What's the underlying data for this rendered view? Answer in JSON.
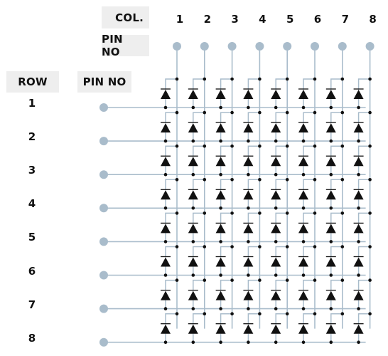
{
  "header": {
    "col_label": "COL.",
    "col_pin_label": "PIN NO",
    "row_label": "ROW",
    "row_pin_label": "PIN NO"
  },
  "columns": [
    "1",
    "2",
    "3",
    "4",
    "5",
    "6",
    "7",
    "8"
  ],
  "rows": [
    "1",
    "2",
    "3",
    "4",
    "5",
    "6",
    "7",
    "8"
  ],
  "colors": {
    "wire": "#a9bccb",
    "pin": "#a9bccb",
    "diode": "#111111",
    "junction": "#111111",
    "label_bg": "#eeeeee"
  },
  "matrix": {
    "type": "8x8 LED matrix",
    "led_count": 64,
    "anode_side": "column",
    "cathode_side": "row"
  }
}
